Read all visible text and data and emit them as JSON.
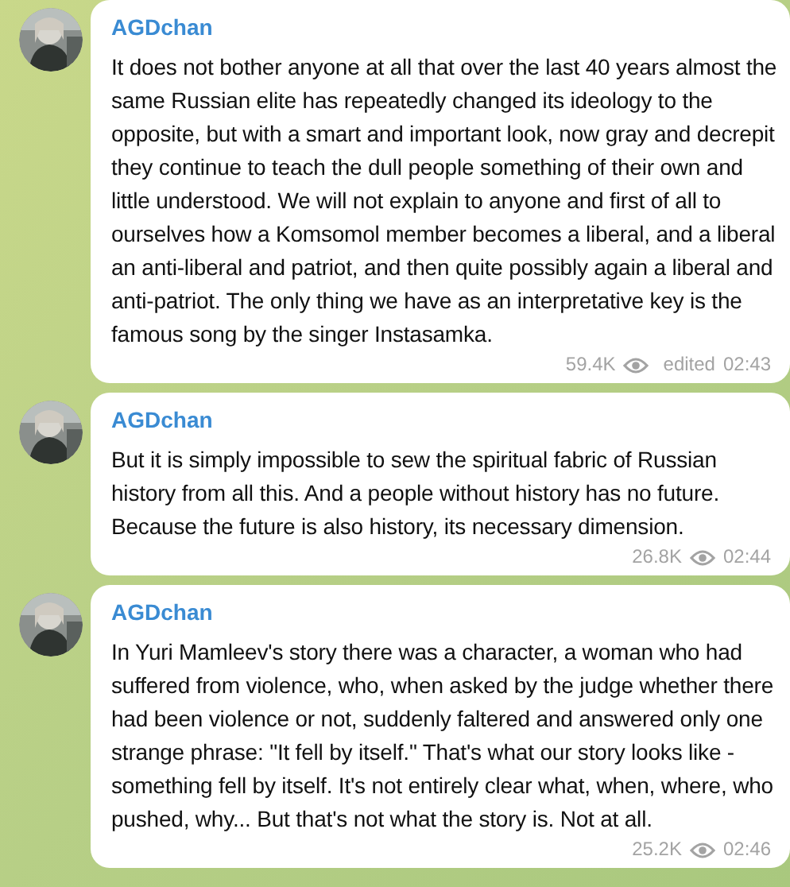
{
  "messages": [
    {
      "author": "AGDchan",
      "text": "It does not bother anyone at all that over the last 40 years almost the same Russian elite has repeatedly changed its ideology to the opposite, but with a smart and important look, now gray and decrepit they continue to teach the dull people something of their own and little understood. We will not explain to anyone and first of all to ourselves how a Komsomol member becomes a liberal, and a liberal an anti-liberal and patriot, and then quite possibly again a liberal and anti-patriot. The only thing we have as an interpretative key is the famous song by the singer Instasamka.",
      "views": "59.4K",
      "edited": "edited",
      "time": "02:43"
    },
    {
      "author": "AGDchan",
      "text": "But it is simply impossible to sew the spiritual fabric of Russian history from all this. And a people without history has no future. Because the future is also history, its necessary dimension.",
      "views": "26.8K",
      "time": "02:44"
    },
    {
      "author": "AGDchan",
      "text": "In Yuri Mamleev's story there was a character, a woman who had suffered from violence, who, when asked by the judge whether there had been violence or not, suddenly faltered and answered only one strange phrase: \"It fell by itself.\" That's what our story looks like - something fell by itself. It's not entirely clear what, when, where, who pushed, why... But that's not what the story is. Not at all.",
      "views": "25.2K",
      "time": "02:46"
    }
  ]
}
